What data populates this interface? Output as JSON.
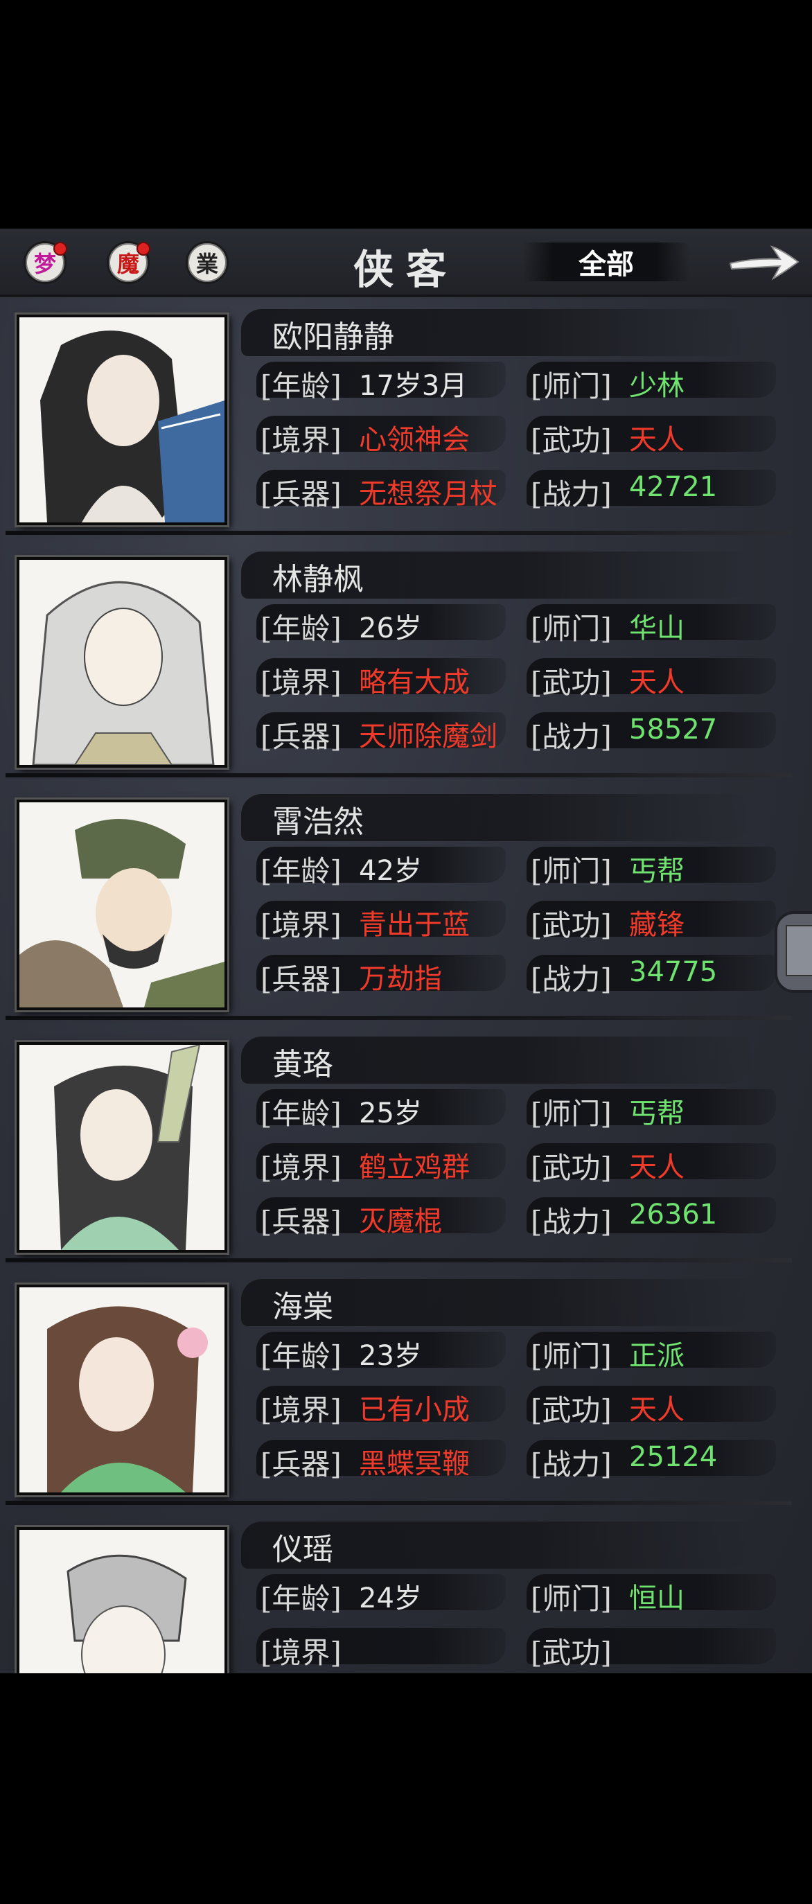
{
  "header": {
    "seals": [
      "梦",
      "魔",
      "業"
    ],
    "seal_colors": [
      "#c0199a",
      "#c81919",
      "#222222"
    ],
    "title": "侠客",
    "filter": "全部"
  },
  "labels": {
    "age": "[年龄]",
    "realm": "[境界]",
    "weapon": "[兵器]",
    "sect": "[师门]",
    "skill": "[武功]",
    "power": "[战力]"
  },
  "characters": [
    {
      "name": "欧阳静静",
      "age": "17岁3月",
      "realm": "心领神会",
      "weapon": "无想祭月杖",
      "sect": "少林",
      "skill": "天人",
      "power": "42721"
    },
    {
      "name": "林静枫",
      "age": "26岁",
      "realm": "略有大成",
      "weapon": "天师除魔剑",
      "sect": "华山",
      "skill": "天人",
      "power": "58527"
    },
    {
      "name": "霄浩然",
      "age": "42岁",
      "realm": "青出于蓝",
      "weapon": "万劫指",
      "sect": "丐帮",
      "skill": "藏锋",
      "power": "34775"
    },
    {
      "name": "黄珞",
      "age": "25岁",
      "realm": "鹤立鸡群",
      "weapon": "灭魔棍",
      "sect": "丐帮",
      "skill": "天人",
      "power": "26361"
    },
    {
      "name": "海棠",
      "age": "23岁",
      "realm": "已有小成",
      "weapon": "黑蝶冥鞭",
      "sect": "正派",
      "skill": "天人",
      "power": "25124"
    },
    {
      "name": "仪瑶",
      "age": "24岁",
      "realm": "",
      "weapon": "",
      "sect": "恒山",
      "skill": "",
      "power": ""
    }
  ]
}
